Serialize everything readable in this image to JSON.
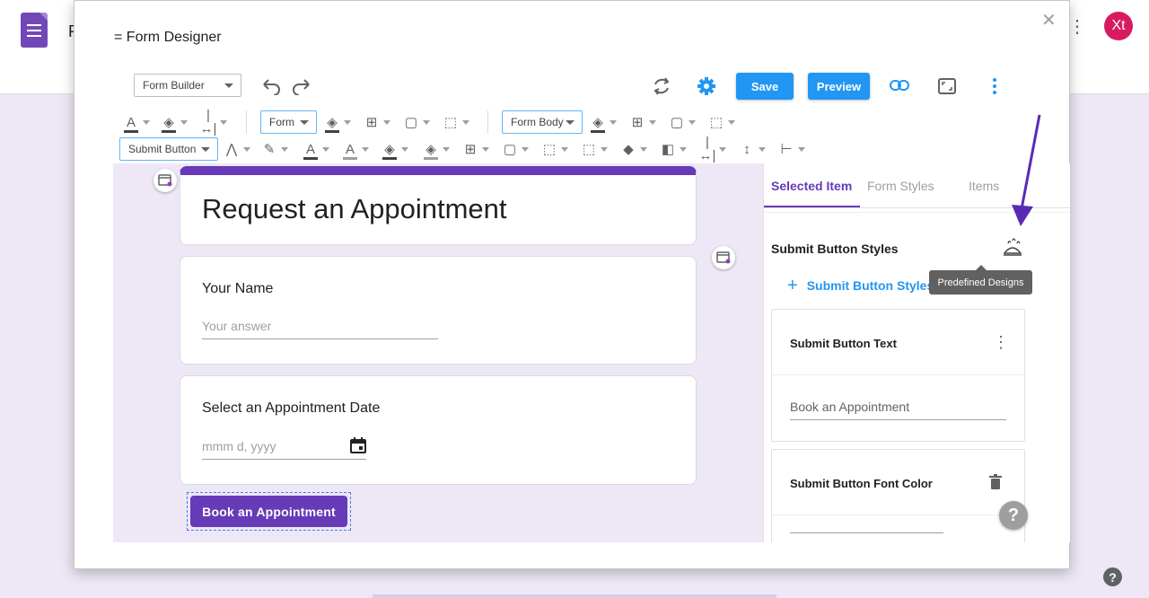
{
  "background": {
    "title_fragment": "R",
    "avatar_initials": "Xt",
    "help_glyph": "?",
    "more_glyph": "⋮"
  },
  "dialog": {
    "title": "= Form Designer",
    "close_glyph": "✕"
  },
  "toolbar": {
    "mode_select": "Form Builder",
    "save_label": "Save",
    "preview_label": "Preview",
    "row1_form_select": "Form",
    "row1_body_select": "Form Body",
    "row2_element_select": "Submit Button",
    "icons": [
      "undo-icon",
      "redo-icon",
      "sync-icon",
      "gear-icon",
      "link-icon",
      "fullscreen-icon",
      "more-vert-icon"
    ]
  },
  "form": {
    "title": "Request an Appointment",
    "questions": [
      {
        "label": "Your Name",
        "placeholder": "Your answer"
      },
      {
        "label": "Select an Appointment Date",
        "placeholder": "mmm d, yyyy"
      }
    ],
    "submit_label": "Book an Appointment"
  },
  "panel": {
    "tabs": [
      "Selected Item",
      "Form Styles",
      "Items"
    ],
    "active_tab": "Selected Item",
    "section_heading": "Submit Button Styles",
    "add_link": "Submit Button Styles",
    "tooltip": "Predefined Designs",
    "cards": [
      {
        "title": "Submit Button Text",
        "value": "Book an Appointment"
      },
      {
        "title": "Submit Button Font Color"
      }
    ],
    "help_glyph": "?"
  },
  "colors": {
    "brand_purple": "#673ab7",
    "accent_blue": "#2196f3",
    "canvas_bg": "#ede7f6",
    "arrow": "#5b2ab5",
    "avatar": "#d81b60"
  }
}
